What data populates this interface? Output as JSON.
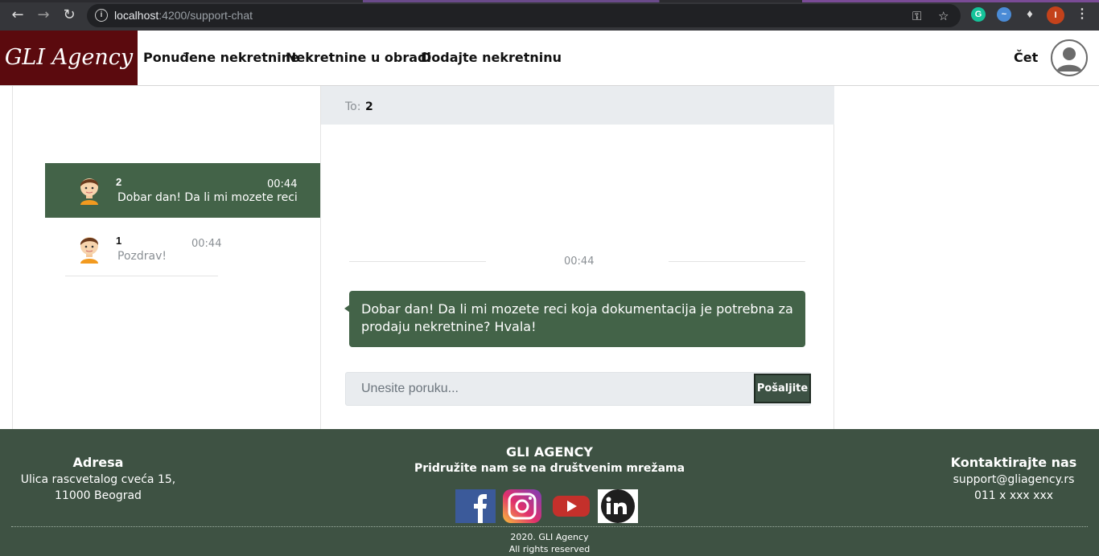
{
  "browser": {
    "url_host": "localhost",
    "url_rest": ":4200/support-chat"
  },
  "navbar": {
    "brand": "GLI Agency",
    "links": [
      "Ponuđene nekretnine",
      "Nekretnine u obradi",
      "Dodajte nekretninu"
    ],
    "chat_link": "Čet"
  },
  "chat_list": [
    {
      "name": "2",
      "time": "00:44",
      "preview": "Dobar dan! Da li mi mozete reci",
      "active": true
    },
    {
      "name": "1",
      "time": "00:44",
      "preview": "Pozdrav!",
      "active": false
    }
  ],
  "conversation": {
    "to_label": "To:",
    "to_value": "2",
    "divider_time": "00:44",
    "messages": [
      {
        "text": "Dobar dan! Da li mi mozete reci koja dokumentacija je potrebna za prodaju nekretnine? Hvala!"
      }
    ],
    "input_placeholder": "Unesite poruku...",
    "send_label": "Pošaljite"
  },
  "footer": {
    "address_title": "Adresa",
    "address_line1": "Ulica rascvetalog cveća 15,",
    "address_line2": "11000 Beograd",
    "center_title": "GLI AGENCY",
    "center_sub": "Pridružite nam se na društvenim mrežama",
    "contact_title": "Kontaktirajte nas",
    "contact_email": "support@gliagency.rs",
    "contact_phone": "011 x xxx xxx",
    "copy_line1": "2020. GLI Agency",
    "copy_line2": "All rights reserved",
    "social": [
      "facebook",
      "instagram",
      "youtube",
      "linkedin"
    ]
  },
  "colors": {
    "brand_bg": "#5b0a0e",
    "accent_green": "#436348",
    "footer_bg": "#3e5243"
  }
}
